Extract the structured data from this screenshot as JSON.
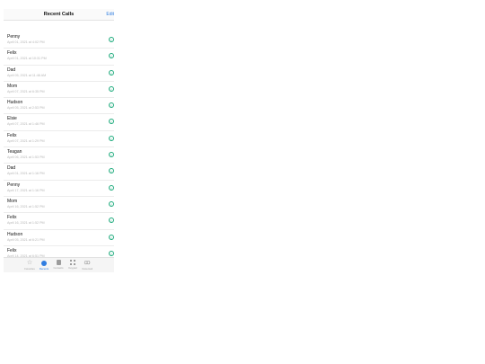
{
  "header": {
    "title": "Recent Calls",
    "edit_label": "Edit"
  },
  "calls": [
    {
      "name": "Penny",
      "time": "April 01, 2021 at 4:02 PM"
    },
    {
      "name": "Felix",
      "time": "April 01, 2021 at 10:31 PM"
    },
    {
      "name": "Dad",
      "time": "April 05, 2021 at 11:46 AM"
    },
    {
      "name": "Mom",
      "time": "April 07, 2021 at 6:35 PM"
    },
    {
      "name": "Hudson",
      "time": "April 05, 2021 at 2:53 PM"
    },
    {
      "name": "Elsie",
      "time": "April 07, 2021 at 1:46 PM"
    },
    {
      "name": "Felix",
      "time": "April 07, 2021 at 1:29 PM"
    },
    {
      "name": "Teagan",
      "time": "April 06, 2021 at 1:53 PM"
    },
    {
      "name": "Dad",
      "time": "April 01, 2021 at 1:16 PM"
    },
    {
      "name": "Penny",
      "time": "April 17, 2021 at 1:16 PM"
    },
    {
      "name": "Mom",
      "time": "April 16, 2021 at 1:52 PM"
    },
    {
      "name": "Felix",
      "time": "April 16, 2021 at 1:52 PM"
    },
    {
      "name": "Hudson",
      "time": "April 05, 2021 at 6:21 PM"
    },
    {
      "name": "Felix",
      "time": "April 14, 2021 at 6:51 PM"
    }
  ],
  "tabs": [
    {
      "label": "Favorites",
      "icon": "star-icon"
    },
    {
      "label": "Recents",
      "icon": "clock-icon"
    },
    {
      "label": "Contacts",
      "icon": "person-icon"
    },
    {
      "label": "Keypad",
      "icon": "keypad-icon"
    },
    {
      "label": "Voicemail",
      "icon": "voicemail-icon"
    }
  ],
  "colors": {
    "accent": "#2f7de1",
    "info": "#1aa97a"
  }
}
